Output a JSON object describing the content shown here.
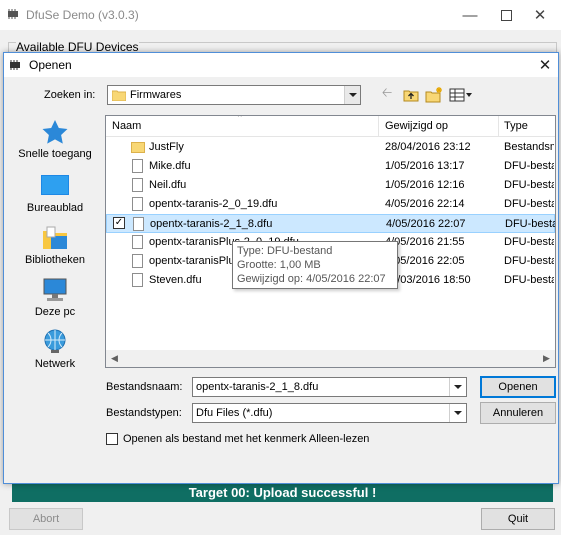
{
  "app": {
    "title": "DfuSe Demo (v3.0.3)",
    "group_label": "Available DFU Devices",
    "status_text": "Target 00: Upload successful !",
    "abort_label": "Abort",
    "quit_label": "Quit",
    "status_color": "#0f6e63"
  },
  "dialog": {
    "title": "Openen",
    "look_in_label": "Zoeken in:",
    "look_in_value": "Firmwares",
    "places": [
      {
        "label": "Snelle toegang",
        "icon": "star-icon"
      },
      {
        "label": "Bureaublad",
        "icon": "desktop-icon"
      },
      {
        "label": "Bibliotheken",
        "icon": "libraries-icon"
      },
      {
        "label": "Deze pc",
        "icon": "computer-icon"
      },
      {
        "label": "Netwerk",
        "icon": "network-icon"
      }
    ],
    "columns": {
      "name": "Naam",
      "modified": "Gewijzigd op",
      "type": "Type"
    },
    "files": [
      {
        "name": "JustFly",
        "modified": "28/04/2016 23:12",
        "type": "Bestandsm",
        "kind": "folder"
      },
      {
        "name": "Mike.dfu",
        "modified": "1/05/2016 13:17",
        "type": "DFU-besta",
        "kind": "file"
      },
      {
        "name": "Neil.dfu",
        "modified": "1/05/2016 12:16",
        "type": "DFU-besta",
        "kind": "file"
      },
      {
        "name": "opentx-taranis-2_0_19.dfu",
        "modified": "4/05/2016 22:14",
        "type": "DFU-besta",
        "kind": "file"
      },
      {
        "name": "opentx-taranis-2_1_8.dfu",
        "modified": "4/05/2016 22:07",
        "type": "DFU-besta",
        "kind": "file",
        "selected": true
      },
      {
        "name": "opentx-taranisPlus-2_0_19.dfu",
        "modified": "4/05/2016 21:55",
        "type": "DFU-besta",
        "kind": "file"
      },
      {
        "name": "opentx-taranisPlus-2_1_8.dfu",
        "modified": "4/05/2016 22:05",
        "type": "DFU-besta",
        "kind": "file"
      },
      {
        "name": "Steven.dfu",
        "modified": "20/03/2016 18:50",
        "type": "DFU-besta",
        "kind": "file"
      }
    ],
    "tooltip": {
      "type": "Type: DFU-bestand",
      "size": "Grootte: 1,00 MB",
      "modified": "Gewijzigd op: 4/05/2016 22:07"
    },
    "filename_label": "Bestandsnaam:",
    "filename_value": "opentx-taranis-2_1_8.dfu",
    "filetype_label": "Bestandstypen:",
    "filetype_value": "Dfu Files (*.dfu)",
    "open_label": "Openen",
    "cancel_label": "Annuleren",
    "readonly_label": "Openen als bestand met het kenmerk Alleen-lezen"
  }
}
